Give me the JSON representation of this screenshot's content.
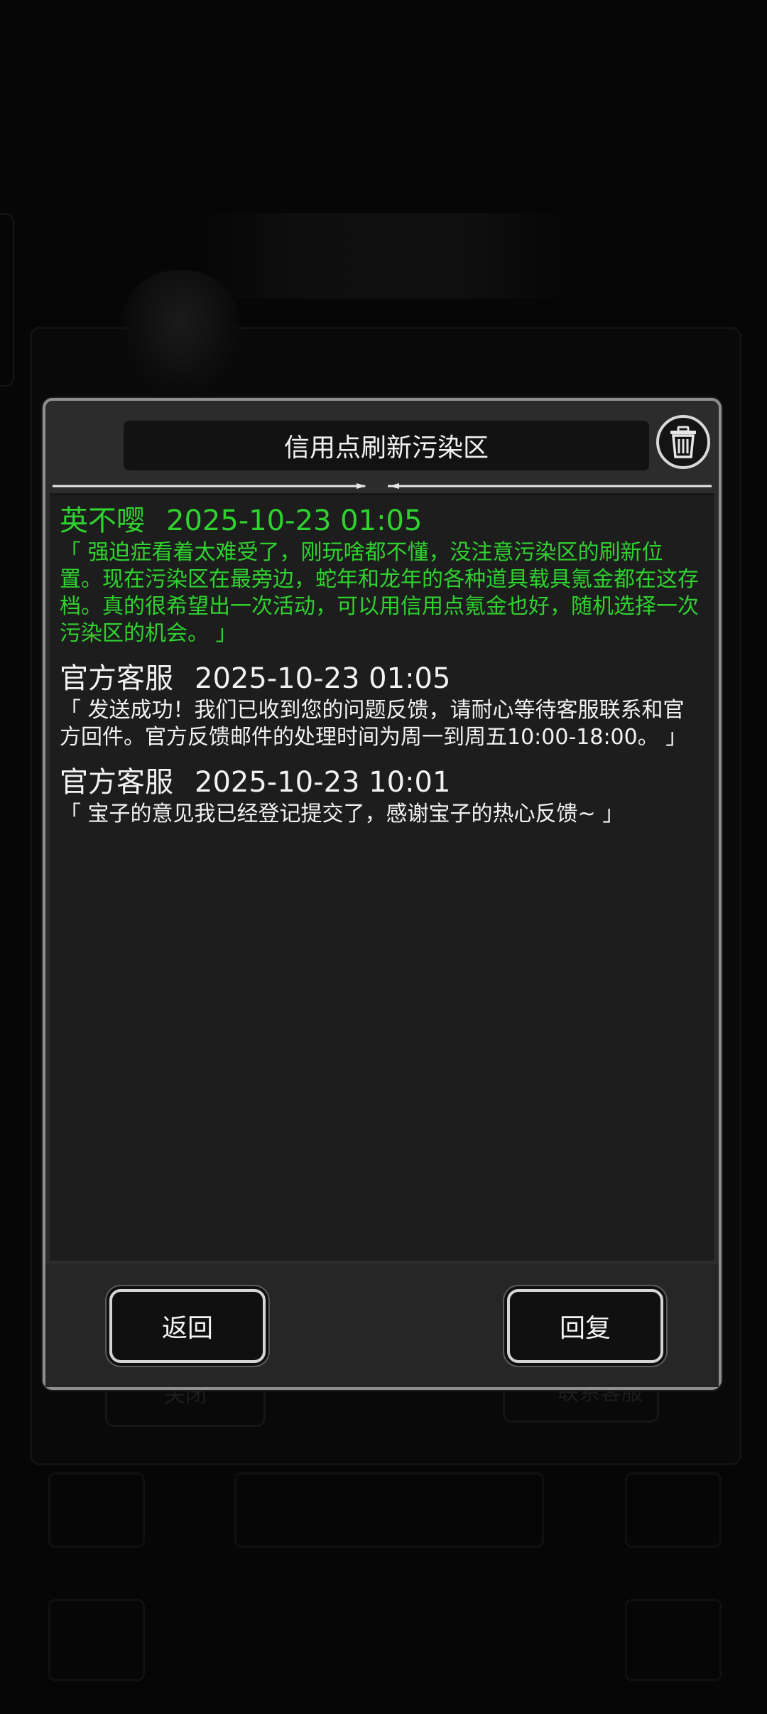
{
  "background": {
    "close_label": "关闭",
    "contact_label": "联系客服"
  },
  "dialog": {
    "title": "信用点刷新污染区",
    "messages": [
      {
        "name": "英不嘤",
        "time": "2025-10-23 01:05",
        "text": "「 强迫症看着太难受了，刚玩啥都不懂，没注意污染区的刷新位置。现在污染区在最旁边，蛇年和龙年的各种道具载具氪金都在这存档。真的很希望出一次活动，可以用信用点氪金也好，随机选择一次污染区的机会。 」",
        "color": "#2fd22f"
      },
      {
        "name": "官方客服",
        "time": "2025-10-23 01:05",
        "text": "「 发送成功！我们已收到您的问题反馈，请耐心等待客服联系和官方回件。官方反馈邮件的处理时间为周一到周五10:00-18:00。 」",
        "color": "#f2f2f2"
      },
      {
        "name": "官方客服",
        "time": "2025-10-23 10:01",
        "text": "「 宝子的意见我已经登记提交了，感谢宝子的热心反馈~ 」",
        "color": "#f2f2f2"
      }
    ],
    "back_label": "返回",
    "reply_label": "回复"
  },
  "icons": {
    "trash": "trash-icon"
  }
}
